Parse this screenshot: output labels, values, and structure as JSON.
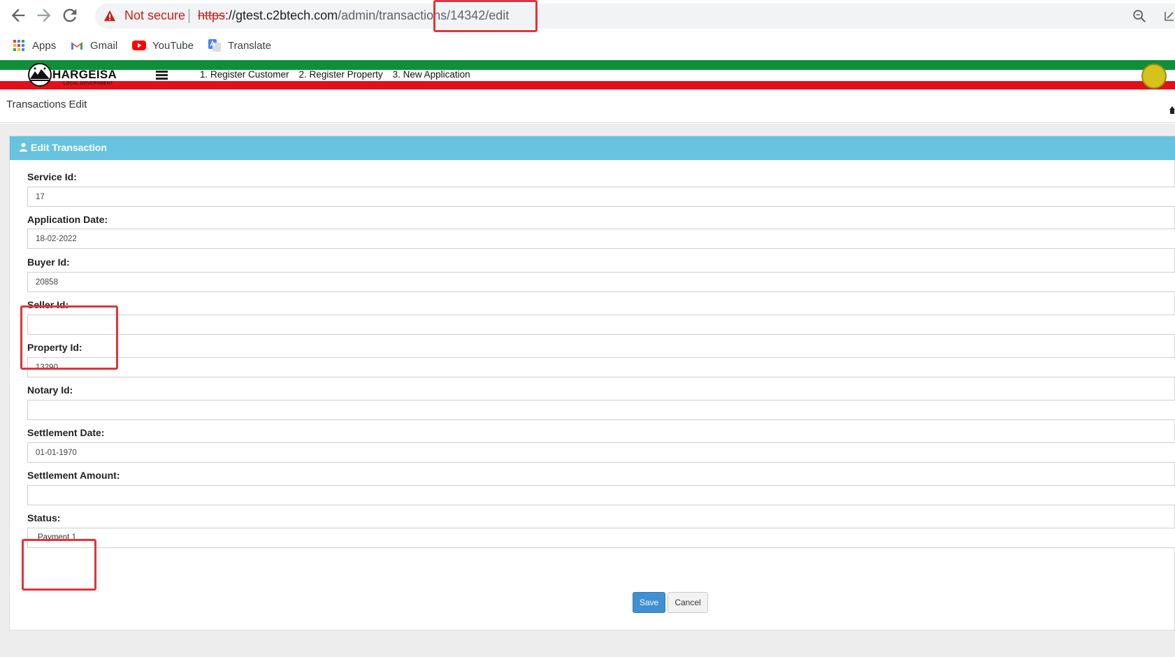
{
  "browser": {
    "security_label": "Not secure",
    "url_scheme": "https",
    "url_host": "://gtest.c2btech.com",
    "url_path": "/admin/transactions/14342/edit"
  },
  "bookmarks": [
    {
      "label": "Apps",
      "icon": "apps-grid-icon"
    },
    {
      "label": "Gmail",
      "icon": "gmail-icon"
    },
    {
      "label": "YouTube",
      "icon": "youtube-icon"
    },
    {
      "label": "Translate",
      "icon": "google-translate-icon"
    }
  ],
  "site": {
    "logo_name": "HARGEISA",
    "logo_sub": "LOCAL GOVERNMENT",
    "nav": [
      "1. Register Customer",
      "2. Register Property",
      "3. New Application"
    ]
  },
  "page": {
    "title": "Transactions Edit",
    "panel_title": "Edit Transaction"
  },
  "form": {
    "fields": [
      {
        "label": "Service Id:",
        "value": "17"
      },
      {
        "label": "Application Date:",
        "value": "18-02-2022"
      },
      {
        "label": "Buyer Id:",
        "value": "20858"
      },
      {
        "label": "Seller Id:",
        "value": ""
      },
      {
        "label": "Property Id:",
        "value": "13290"
      },
      {
        "label": "Notary Id:",
        "value": ""
      },
      {
        "label": "Settlement Date:",
        "value": "01-01-1970"
      },
      {
        "label": "Settlement Amount:",
        "value": ""
      }
    ],
    "status_label": "Status:",
    "status_value": "Payment 1",
    "save_label": "Save",
    "cancel_label": "Cancel"
  },
  "colors": {
    "panel_header": "#67c3e0",
    "flag_green": "#0f8f3a",
    "flag_red": "#e3101b",
    "save_button": "#3f8fd2",
    "annotation": "#e0353b"
  }
}
